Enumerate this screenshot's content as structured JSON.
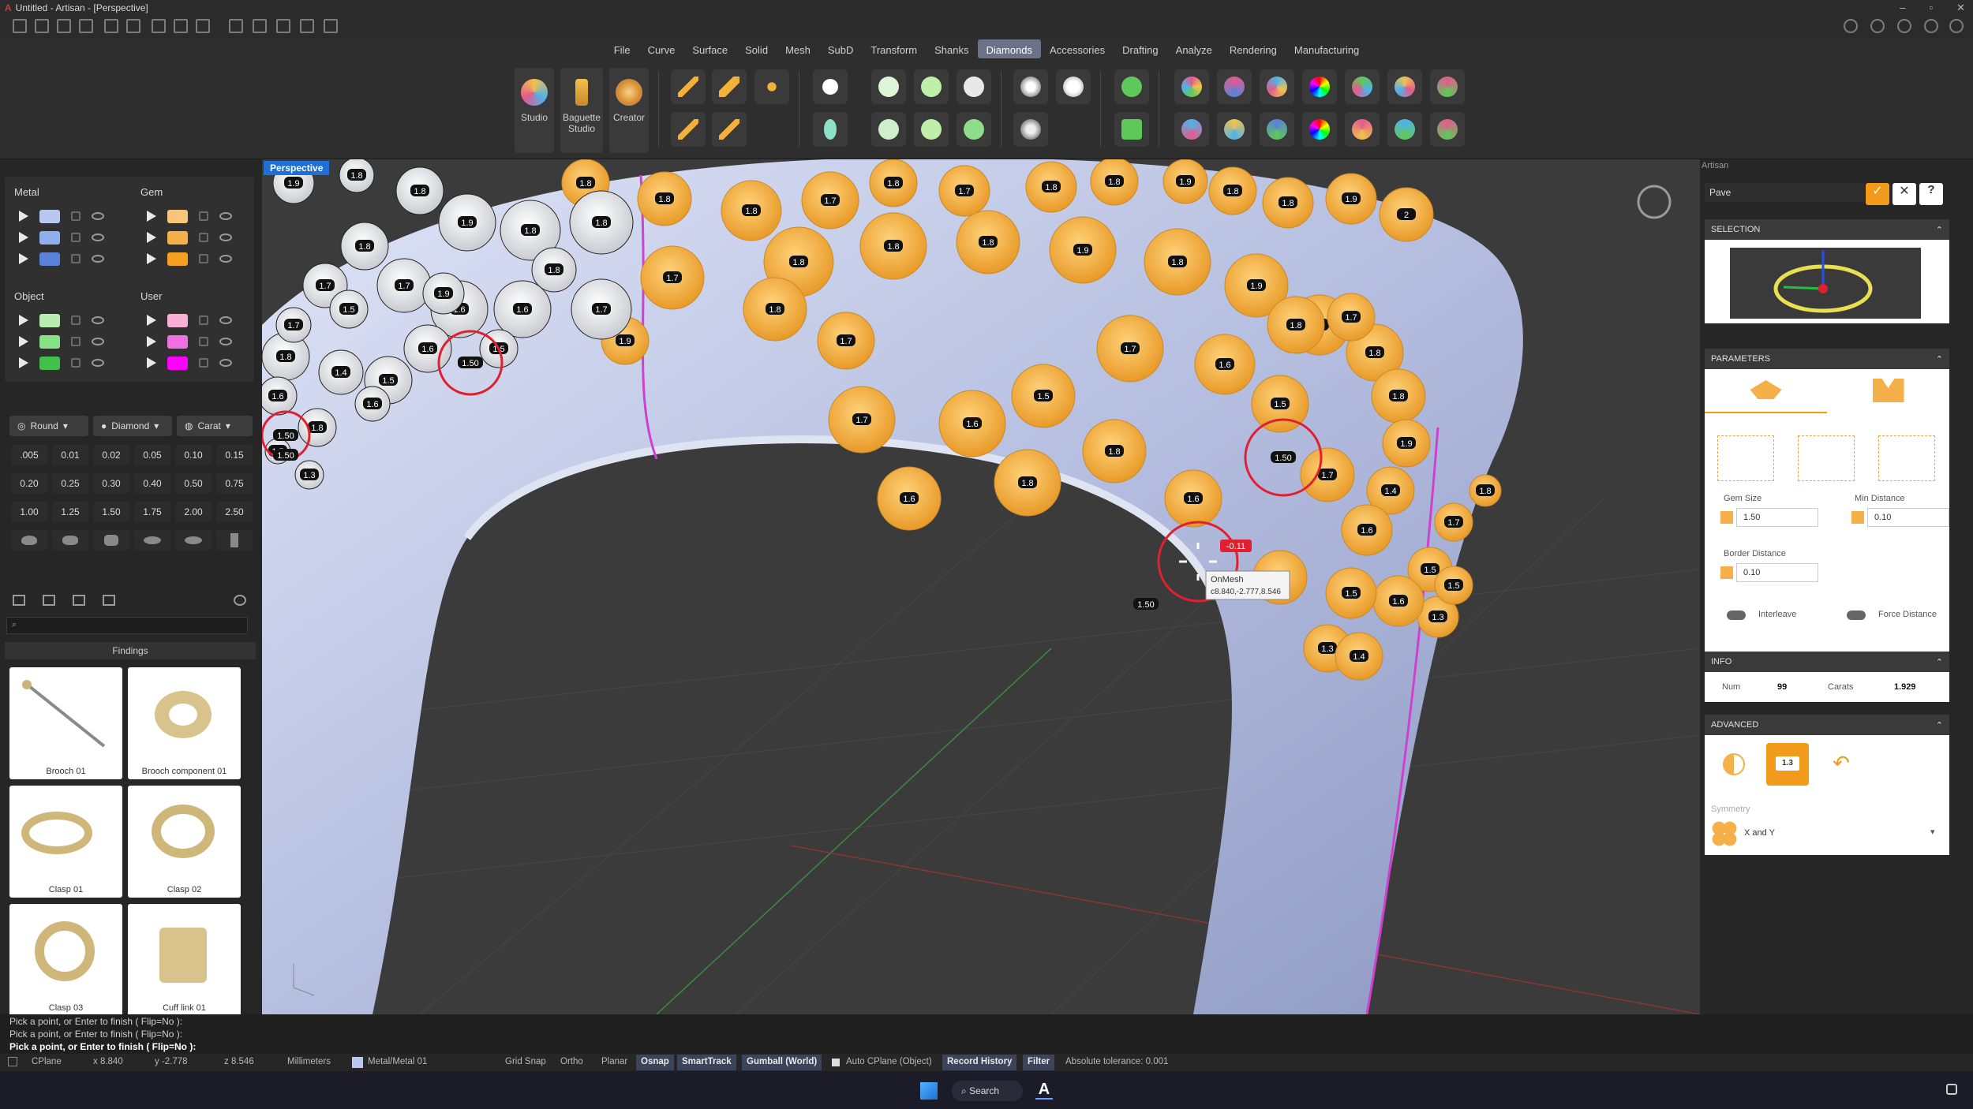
{
  "window": {
    "title": "Untitled - Artisan - [Perspective]"
  },
  "menu": [
    "File",
    "Curve",
    "Surface",
    "Solid",
    "Mesh",
    "SubD",
    "Transform",
    "Shanks",
    "Diamonds",
    "Accessories",
    "Drafting",
    "Analyze",
    "Rendering",
    "Manufacturing"
  ],
  "menu_active": "Diamonds",
  "ribbon": {
    "big": [
      {
        "label": "Studio",
        "icon": "studio-icon",
        "color": "#c8a040"
      },
      {
        "label": "Baguette Studio",
        "icon": "baguette-icon",
        "color": "#e0a84a"
      },
      {
        "label": "Creator",
        "icon": "creator-icon",
        "color": "#d99a3a"
      }
    ]
  },
  "layers": {
    "metal": {
      "title": "Metal",
      "colors": [
        "#b9c8f0",
        "#8fb0ec",
        "#5a82d8"
      ]
    },
    "gem": {
      "title": "Gem",
      "colors": [
        "#f7c67a",
        "#f5b04a",
        "#f5a020"
      ]
    },
    "object": {
      "title": "Object",
      "colors": [
        "#b8efb0",
        "#86e282",
        "#42c04a"
      ]
    },
    "user": {
      "title": "User",
      "colors": [
        "#f7b0d6",
        "#f070e0",
        "#ff00ff"
      ]
    }
  },
  "gem_controls": {
    "shape": "Round",
    "type": "Diamond",
    "unit": "Carat"
  },
  "sizes": [
    ".005",
    "0.01",
    "0.02",
    "0.05",
    "0.10",
    "0.15",
    "0.20",
    "0.25",
    "0.30",
    "0.40",
    "0.50",
    "0.75",
    "1.00",
    "1.25",
    "1.50",
    "1.75",
    "2.00",
    "2.50"
  ],
  "library": {
    "category": "Findings",
    "search_placeholder": "",
    "items": [
      {
        "label": "Brooch 01"
      },
      {
        "label": "Brooch component 01"
      },
      {
        "label": "Clasp 01"
      },
      {
        "label": "Clasp 02"
      },
      {
        "label": "Clasp 03"
      },
      {
        "label": "Cuff link 01"
      }
    ]
  },
  "viewport": {
    "name": "Perspective",
    "tooltip_title": "OnMesh",
    "tooltip_coords": "c8.840,-2.777,8.546",
    "readout": "-0.11"
  },
  "gems": {
    "gold": [
      "1.8",
      "1.8",
      "1.8",
      "1.7",
      "1.8",
      "1.7",
      "1.8",
      "1.8",
      "1.9",
      "1.8",
      "1.8",
      "1.9",
      "2",
      "1.7",
      "1.8",
      "1.8",
      "1.8",
      "1.9",
      "1.8",
      "1.9",
      "2",
      "1.8",
      "1.8",
      "1.9",
      "1.7",
      "1.8",
      "1.6",
      "1.7",
      "1.5",
      "1.6",
      "1.7",
      "1.6",
      "1.8",
      "1.8",
      "1.6",
      "1.5",
      "1.7",
      "1.4",
      "1.6",
      "1.5",
      "1.3",
      "1.6",
      "1.7",
      "1.5",
      "1.6",
      "1.5",
      "1.3",
      "1.4",
      "1.9",
      "1.8",
      "1.7",
      "1.8"
    ],
    "white": [
      "1.9",
      "1.8",
      "1.8",
      "1.9",
      "1.8",
      "1.8",
      "1.8",
      "1.7",
      "1.7",
      "1.6",
      "1.6",
      "1.7",
      "1.8",
      "1.4",
      "1.5",
      "1.6",
      "1.8",
      "1.6",
      "1.7",
      "1.5",
      "1.5",
      "1.3",
      "1.6",
      "1.9",
      "1.5",
      "1.8"
    ],
    "markers": [
      "1.50",
      "1.50",
      "1.50",
      "1.50",
      "1.50"
    ]
  },
  "artisan": {
    "header": "Artisan",
    "command": "Pave",
    "sections": {
      "selection": "SELECTION",
      "parameters": "PARAMETERS",
      "info": "INFO",
      "advanced": "ADVANCED"
    },
    "params": {
      "gem_size_label": "Gem Size",
      "gem_size": "1.50",
      "min_dist_label": "Min Distance",
      "min_dist": "0.10",
      "border_label": "Border Distance",
      "border": "0.10",
      "interleave": "Interleave",
      "force": "Force Distance"
    },
    "info": {
      "num_label": "Num",
      "num": "99",
      "carats_label": "Carats",
      "carats": "1.929"
    },
    "advanced": {
      "value": "1.3",
      "symmetry_label": "Symmetry",
      "symmetry": "X and Y"
    }
  },
  "command": {
    "lines": [
      "Pick a point, or Enter to finish ( Flip=No ):",
      "Pick a point, or Enter to finish ( Flip=No ):",
      "Pick a point, or Enter to finish ( Flip=No ):"
    ]
  },
  "status": {
    "cplane": "CPlane",
    "x": "x 8.840",
    "y": "y -2.778",
    "z": "z 8.546",
    "units": "Millimeters",
    "layer": "Metal/Metal 01",
    "grid_snap": "Grid Snap",
    "ortho": "Ortho",
    "planar": "Planar",
    "osnap": "Osnap",
    "smarttrack": "SmartTrack",
    "gumball": "Gumball (World)",
    "auto_cplane": "Auto CPlane (Object)",
    "record_history": "Record History",
    "filter": "Filter",
    "tolerance": "Absolute tolerance: 0.001"
  },
  "taskbar": {
    "search": "Search"
  }
}
